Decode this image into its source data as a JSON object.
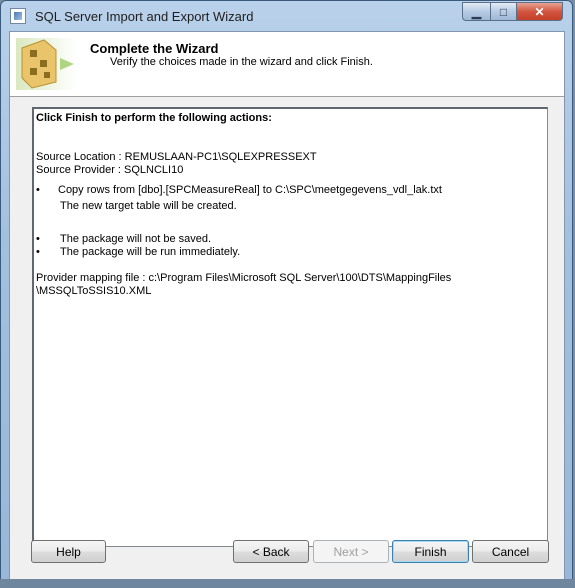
{
  "window": {
    "title": "SQL Server Import and Export Wizard",
    "minimize_glyph": "▁",
    "maximize_glyph": "□",
    "close_glyph": "✕"
  },
  "header": {
    "title": "Complete the Wizard",
    "subtitle": "Verify the choices made in the wizard and click Finish."
  },
  "report": {
    "heading": "Click Finish to perform the following actions:",
    "source_location": "Source Location : REMUSLAAN-PC1\\SQLEXPRESSEXT",
    "source_provider": "Source Provider : SQLNCLI10",
    "bullets": [
      {
        "text": "Copy rows from [dbo].[SPCMeasureReal] to C:\\SPC\\meetgegevens_vdl_lak.txt"
      },
      {
        "text": "The new target table will be created."
      },
      {
        "text": "The package will not be saved."
      },
      {
        "text": "The package will be run immediately."
      }
    ],
    "mapping_line1": "Provider mapping file : c:\\Program Files\\Microsoft SQL Server\\100\\DTS\\MappingFiles",
    "mapping_line2": "\\MSSQLToSSIS10.XML"
  },
  "buttons": {
    "help": "Help",
    "back": "< Back",
    "next": "Next >",
    "finish": "Finish",
    "cancel": "Cancel"
  },
  "colors": {
    "accent": "#3c7fb1",
    "close": "#c4402a"
  }
}
